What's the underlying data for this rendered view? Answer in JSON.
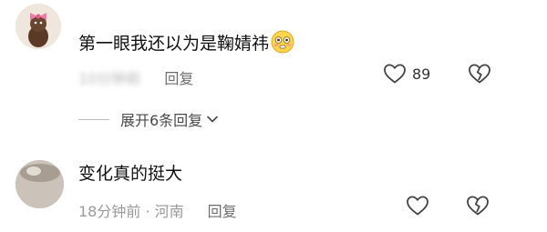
{
  "comments": [
    {
      "text": "第一眼我还以为是鞠婧祎",
      "emoji": "flushed-face-emoji",
      "meta_blurred": "10分钟前",
      "reply_label": "回复",
      "like_count": "89",
      "like_icon": "heart-icon",
      "dislike_icon": "broken-heart-icon"
    },
    {
      "text": "变化真的挺大",
      "meta": "18分钟前 · 河南",
      "reply_label": "回复",
      "like_icon": "heart-icon",
      "dislike_icon": "broken-heart-icon"
    }
  ],
  "expand_replies": {
    "label": "展开6条回复",
    "icon": "chevron-down-icon"
  },
  "colors": {
    "text": "#111111",
    "meta": "#9a9a9a",
    "reply": "#6e6e6e",
    "avatar_bow": "#f07aa6"
  }
}
